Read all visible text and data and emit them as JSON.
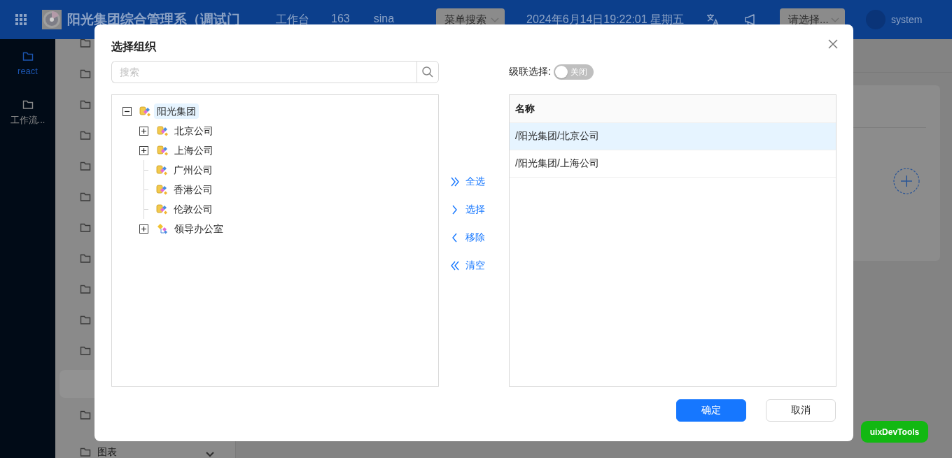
{
  "header": {
    "title": "阳光集团综合管理系（调试门",
    "nav": [
      "工作台",
      "163",
      "sina"
    ],
    "menu_search": {
      "placeholder": "菜单搜索"
    },
    "datetime": "2024年6月14日19:22:01 星期五",
    "org_select": {
      "placeholder": "请选择..."
    },
    "user": "system"
  },
  "sidebar": {
    "items": [
      {
        "label": "react",
        "selected": true
      },
      {
        "label": "工作流...",
        "selected": false
      }
    ]
  },
  "submenu": {
    "items": [
      {
        "kind": "folder",
        "selected": false
      },
      {
        "kind": "folder",
        "selected": false
      },
      {
        "kind": "folder",
        "selected": false
      },
      {
        "kind": "folder",
        "selected": false
      },
      {
        "kind": "folder",
        "selected": false
      },
      {
        "kind": "folder",
        "selected": false
      },
      {
        "kind": "folder",
        "selected": false
      },
      {
        "kind": "folder",
        "selected": false
      },
      {
        "kind": "folder",
        "selected": false
      },
      {
        "kind": "folder",
        "selected": false
      },
      {
        "kind": "folder",
        "selected": false
      },
      {
        "kind": "leaf",
        "selected": true
      },
      {
        "kind": "folder",
        "selected": false
      },
      {
        "kind": "folder",
        "selected": false,
        "label": "图表",
        "expanded": false
      }
    ]
  },
  "dialog": {
    "title": "选择组织",
    "search": {
      "placeholder": "搜索"
    },
    "tree": [
      {
        "label": "阳光集团",
        "kind": "company",
        "expanded": true,
        "selected": true,
        "children": [
          {
            "label": "北京公司",
            "kind": "company",
            "expanded": false,
            "selected": false
          },
          {
            "label": "上海公司",
            "kind": "company",
            "expanded": false,
            "selected": false
          },
          {
            "label": "广州公司",
            "kind": "company",
            "selected": false
          },
          {
            "label": "香港公司",
            "kind": "company",
            "selected": false
          },
          {
            "label": "伦敦公司",
            "kind": "company",
            "selected": false
          },
          {
            "label": "领导办公室",
            "kind": "department",
            "expanded": false,
            "selected": false
          }
        ]
      }
    ],
    "transfer_buttons": [
      {
        "label": "全选",
        "kind": "all_right"
      },
      {
        "label": "选择",
        "kind": "right"
      },
      {
        "label": "移除",
        "kind": "left"
      },
      {
        "label": "清空",
        "kind": "all_left"
      }
    ],
    "cascade": {
      "label": "级联选择:",
      "on": false,
      "text": "关闭"
    },
    "table": {
      "columns": [
        "名称"
      ],
      "rows": [
        {
          "name": "/阳光集团/北京公司",
          "selected": true
        },
        {
          "name": "/阳光集团/上海公司",
          "selected": false
        }
      ]
    },
    "buttons": [
      {
        "label": "确定",
        "kind": "primary"
      },
      {
        "label": "取消",
        "kind": "default"
      }
    ]
  },
  "dev_tools_button": "uixDevTools"
}
